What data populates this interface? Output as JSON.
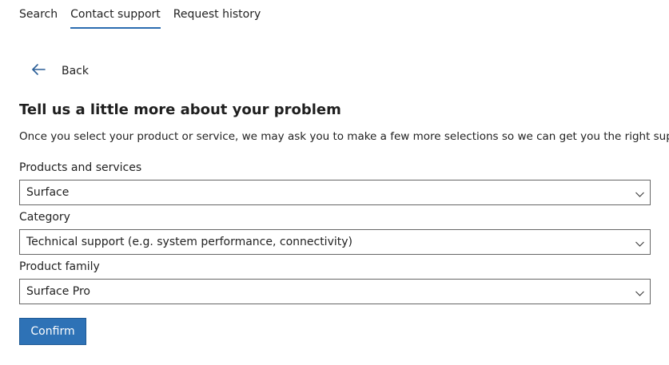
{
  "tabs": [
    {
      "label": "Search"
    },
    {
      "label": "Contact support"
    },
    {
      "label": "Request history"
    }
  ],
  "back": {
    "label": "Back",
    "icon": "arrow-left-icon"
  },
  "title": "Tell us a little more about your problem",
  "description": "Once you select your product or service, we may ask you to make a few more selections so we can get you the right support.",
  "fields": [
    {
      "label": "Products and services",
      "value": "Surface"
    },
    {
      "label": "Category",
      "value": "Technical support (e.g. system performance, connectivity)"
    },
    {
      "label": "Product family",
      "value": "Surface Pro"
    }
  ],
  "confirm": {
    "label": "Confirm"
  },
  "colors": {
    "accent": "#2e72b6",
    "tab_underline": "#2b6cb0"
  }
}
